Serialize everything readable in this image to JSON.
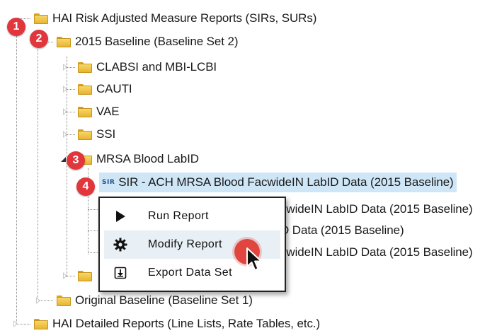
{
  "tree": {
    "root1": {
      "label": "HAI Risk Adjusted Measure Reports (SIRs, SURs)"
    },
    "baseline2015": {
      "label": "2015 Baseline (Baseline Set 2)"
    },
    "children": [
      {
        "label": "CLABSI and MBI-LCBI"
      },
      {
        "label": "CAUTI"
      },
      {
        "label": "VAE"
      },
      {
        "label": "SSI"
      },
      {
        "label": "MRSA Blood LabID"
      }
    ],
    "reports": [
      {
        "badge": "SIR",
        "label": "SIR - ACH MRSA Blood FacwideIN LabID Data (2015 Baseline)"
      },
      {
        "label": "cwideIN LabID Data (2015 Baseline)"
      },
      {
        "label": "D Data (2015 Baseline)"
      },
      {
        "label": "cwideIN LabID Data (2015 Baseline)"
      }
    ],
    "original_baseline": {
      "label": "Original Baseline (Baseline Set 1)"
    },
    "root2": {
      "label": "HAI Detailed Reports (Line Lists, Rate Tables, etc.)"
    }
  },
  "steps": [
    "1",
    "2",
    "3",
    "4"
  ],
  "context_menu": {
    "items": [
      {
        "label": "Run Report",
        "icon": "play-icon"
      },
      {
        "label": "Modify Report",
        "icon": "gear-icon"
      },
      {
        "label": "Export Data Set",
        "icon": "export-icon"
      }
    ]
  },
  "colors": {
    "selection": "#cfe6f7",
    "step_badge": "#e0363c",
    "folder": "#f2c94c",
    "menu_hover": "#e8eff5"
  }
}
